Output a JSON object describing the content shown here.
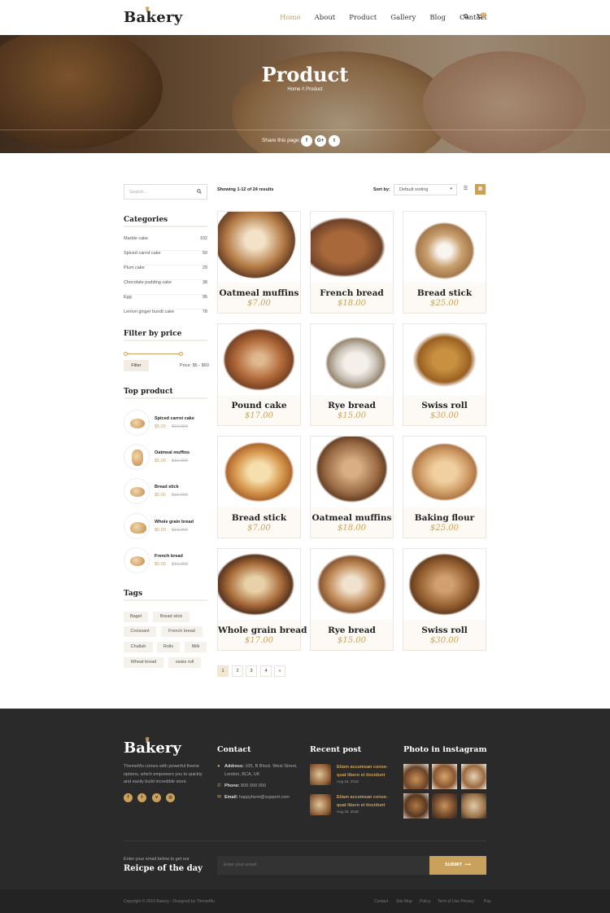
{
  "header": {
    "logo": "Bakery",
    "nav": [
      "Home",
      "About",
      "Product",
      "Gallery",
      "Blog",
      "Contact"
    ],
    "active": "Home",
    "cart_count": "0"
  },
  "hero": {
    "title": "Product",
    "breadcrumb": "Home  /\\  Product",
    "share_label": "Share this page:",
    "social": [
      "f",
      "G+",
      "t"
    ]
  },
  "sidebar": {
    "search_placeholder": "Search...",
    "categories_title": "Categories",
    "categories": [
      {
        "label": "Marble cake",
        "count": "102"
      },
      {
        "label": "Spiced carrot cake",
        "count": "50"
      },
      {
        "label": "Plum cake",
        "count": "29"
      },
      {
        "label": "Chocolate pudding cake",
        "count": "38"
      },
      {
        "label": "Egg",
        "count": "95"
      },
      {
        "label": "Lemon ginger bundt cake",
        "count": "78"
      }
    ],
    "filter_title": "Filter by price",
    "filter_button": "Filter",
    "price_range": "Price: $5 - $50",
    "top_title": "Top product",
    "top_products": [
      {
        "name": "Spiced carrot cake",
        "price": "$5.00",
        "old": "$10.000"
      },
      {
        "name": "Oatmeal muffins",
        "price": "$5.00",
        "old": "$10.000"
      },
      {
        "name": "Bread stick",
        "price": "$5.00",
        "old": "$10.000"
      },
      {
        "name": "Whole grain bread",
        "price": "$5.00",
        "old": "$10.000"
      },
      {
        "name": "French bread",
        "price": "$5.00",
        "old": "$10.000"
      }
    ],
    "tags_title": "Tags",
    "tags": [
      "Bagel",
      "Bread stick",
      "Croissant",
      "French bread",
      "Challah",
      "Rolls",
      "Milk",
      "Wheat bread",
      "swiss roll"
    ]
  },
  "toolbar": {
    "showing": "Showing 1-12 of 24 results",
    "sort_label": "Sort by:",
    "sort_value": "Default sorting"
  },
  "products": [
    {
      "title": "Oatmeal muffins",
      "price": "$7.00"
    },
    {
      "title": "French bread",
      "price": "$18.00"
    },
    {
      "title": "Bread stick",
      "price": "$25.00"
    },
    {
      "title": "Pound cake",
      "price": "$17.00"
    },
    {
      "title": "Rye bread",
      "price": "$15.00"
    },
    {
      "title": "Swiss roll",
      "price": "$30.00"
    },
    {
      "title": "Bread stick",
      "price": "$7.00"
    },
    {
      "title": "Oatmeal muffins",
      "price": "$18.00"
    },
    {
      "title": "Baking flour",
      "price": "$25.00"
    },
    {
      "title": "Whole grain bread",
      "price": "$17.00"
    },
    {
      "title": "Rye bread",
      "price": "$15.00"
    },
    {
      "title": "Swiss roll",
      "price": "$30.00"
    }
  ],
  "pagination": [
    "1",
    "2",
    "3",
    "4",
    "»"
  ],
  "footer": {
    "logo": "Bakery",
    "about": "ThemeMu comes with powerful theme options, which empowers you to quickly and easily build incredible store.",
    "social": [
      "f",
      "t",
      "v",
      "◎"
    ],
    "contact_title": "Contact",
    "address_label": "Address:",
    "address": "105, B Block. West Street, London, BCA, UK",
    "phone_label": "Phone:",
    "phone": "800 000 000",
    "email_label": "Email:",
    "email": "happyfarm@support.com",
    "recent_title": "Recent post",
    "recent": [
      {
        "title": "Etiam accumsan conse-quat libero et tincidunt",
        "date": "Aug 18, 2018"
      },
      {
        "title": "Etiam accumsan conse-quat libero et tincidunt",
        "date": "Aug 18, 2018"
      }
    ],
    "instagram_title": "Photo in instagram",
    "newsletter_small": "Enter your email below to get our",
    "newsletter_big": "Reicpe of the day",
    "newsletter_placeholder": "Enter your email",
    "submit": "SUBMIT",
    "copyright": "Copyright © 2019 Bakery - Designed by ThemeMu",
    "links": [
      "Contact",
      "Site Map",
      "Policy",
      "Term of Use Privacy",
      "Pay"
    ]
  },
  "colors": {
    "accent": "#c9a15c",
    "footer_bg": "#2a2a2a"
  }
}
